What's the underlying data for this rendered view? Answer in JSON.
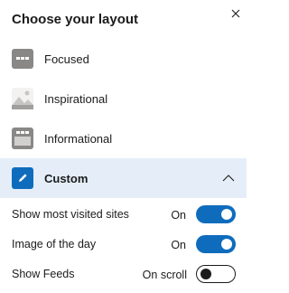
{
  "panel": {
    "title": "Choose your layout",
    "close_icon": "close-icon"
  },
  "layouts": [
    {
      "label": "Focused",
      "icon": "focused-layout-icon"
    },
    {
      "label": "Inspirational",
      "icon": "inspirational-image-icon"
    },
    {
      "label": "Informational",
      "icon": "informational-layout-icon"
    },
    {
      "label": "Custom",
      "icon": "pencil-icon",
      "selected": true,
      "expanded": true
    }
  ],
  "settings": [
    {
      "label": "Show most visited sites",
      "value": "On",
      "toggle_on": true
    },
    {
      "label": "Image of the day",
      "value": "On",
      "toggle_on": true
    },
    {
      "label": "Show Feeds",
      "value": "On scroll",
      "toggle_on": false
    }
  ],
  "colors": {
    "accent": "#0f6cbd",
    "selected_row_bg": "#e5eef8",
    "icon_gray": "#8a8886"
  }
}
